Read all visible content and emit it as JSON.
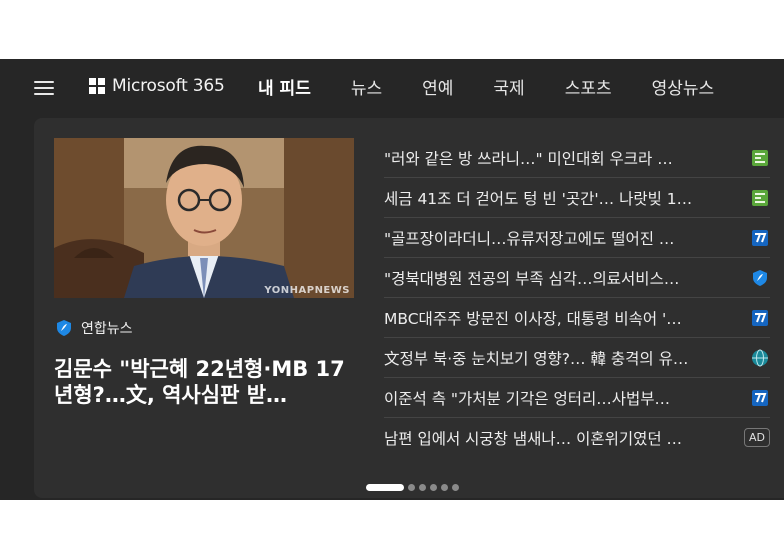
{
  "nav": {
    "brand": "Microsoft 365",
    "tabs": [
      "내 피드",
      "뉴스",
      "연예",
      "국제",
      "스포츠",
      "영상뉴스"
    ],
    "active_tab": "내 피드"
  },
  "featured": {
    "image_watermark": "YONHAPNEWS",
    "source": "연합뉴스",
    "headline": "김문수 \"박근혜 22년형·MB 17년형?…文, 역사심판 받…"
  },
  "news_items": [
    {
      "title": "\"러와 같은 방 쓰라니…\" 미인대회 우크라 …",
      "icon": "green-news-icon"
    },
    {
      "title": "세금 41조 더 걷어도 텅 빈 '곳간'… 나랏빚 1…",
      "icon": "green-news-icon"
    },
    {
      "title": "\"골프장이라더니…유류저장고에도 떨어진 …",
      "icon": "blue-news-icon"
    },
    {
      "title": "\"경북대병원 전공의 부족 심각…의료서비스…",
      "icon": "yonhap-shield-icon"
    },
    {
      "title": "MBC대주주 방문진 이사장, 대통령 비속어 '…",
      "icon": "blue-news-icon"
    },
    {
      "title": "文정부 북·중 눈치보기 영향?… 韓 충격의 유…",
      "icon": "globe-icon"
    },
    {
      "title": "이준석 측 \"가처분 기각은 엉터리…사법부…",
      "icon": "blue-news-icon"
    },
    {
      "title": "남편 입에서 시궁창 냄새나… 이혼위기였던 …",
      "icon": "ad-badge",
      "badge": "AD"
    }
  ],
  "pager": {
    "total": 6,
    "active": 0
  },
  "colors": {
    "background": "#262626",
    "card": "#2f2f2f",
    "accent_green": "#4caf50",
    "accent_blue": "#1565c0"
  }
}
